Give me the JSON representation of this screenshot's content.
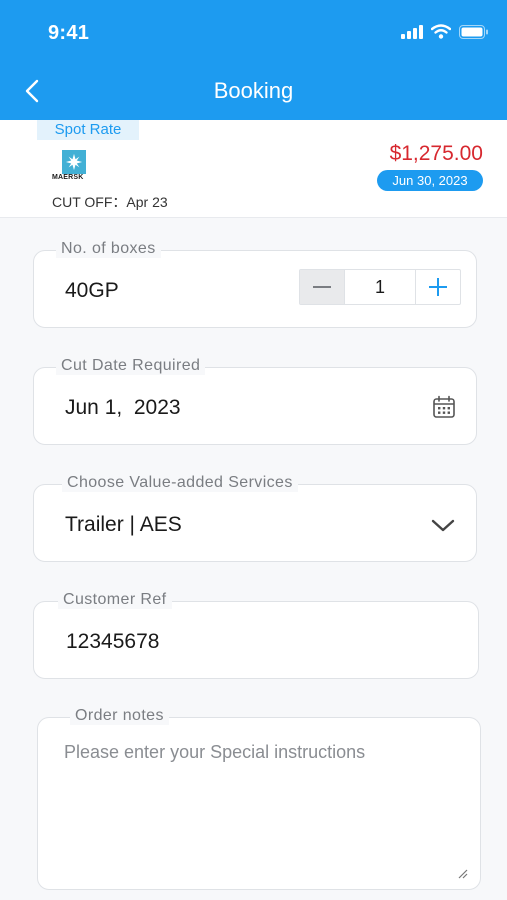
{
  "status_bar": {
    "time": "9:41"
  },
  "header": {
    "title": "Booking"
  },
  "rate_card": {
    "badge": "Spot Rate",
    "carrier_logo_text": "MAERSK",
    "cutoff": "CUT OFF：Apr 23",
    "price": "$1,275.00",
    "date": "Jun 30, 2023"
  },
  "form": {
    "boxes": {
      "label": "No. of boxes",
      "container_type": "40GP",
      "quantity": "1"
    },
    "cut_date": {
      "label": "Cut Date Required",
      "value": "Jun 1,  2023"
    },
    "services": {
      "label": "Choose Value-added Services",
      "value": "Trailer | AES"
    },
    "customer_ref": {
      "label": "Customer Ref",
      "value": "12345678"
    },
    "order_notes": {
      "label": "Order notes",
      "placeholder": "Please enter your Special instructions"
    }
  },
  "colors": {
    "primary": "#1d9bf0",
    "price": "#d7282f",
    "maersk": "#42b0d5"
  },
  "icons": [
    "signal-icon",
    "wifi-icon",
    "battery-icon",
    "back-arrow-icon",
    "maersk-star-icon",
    "minus-icon",
    "plus-icon",
    "calendar-icon",
    "chevron-down-icon",
    "resize-grip-icon"
  ]
}
